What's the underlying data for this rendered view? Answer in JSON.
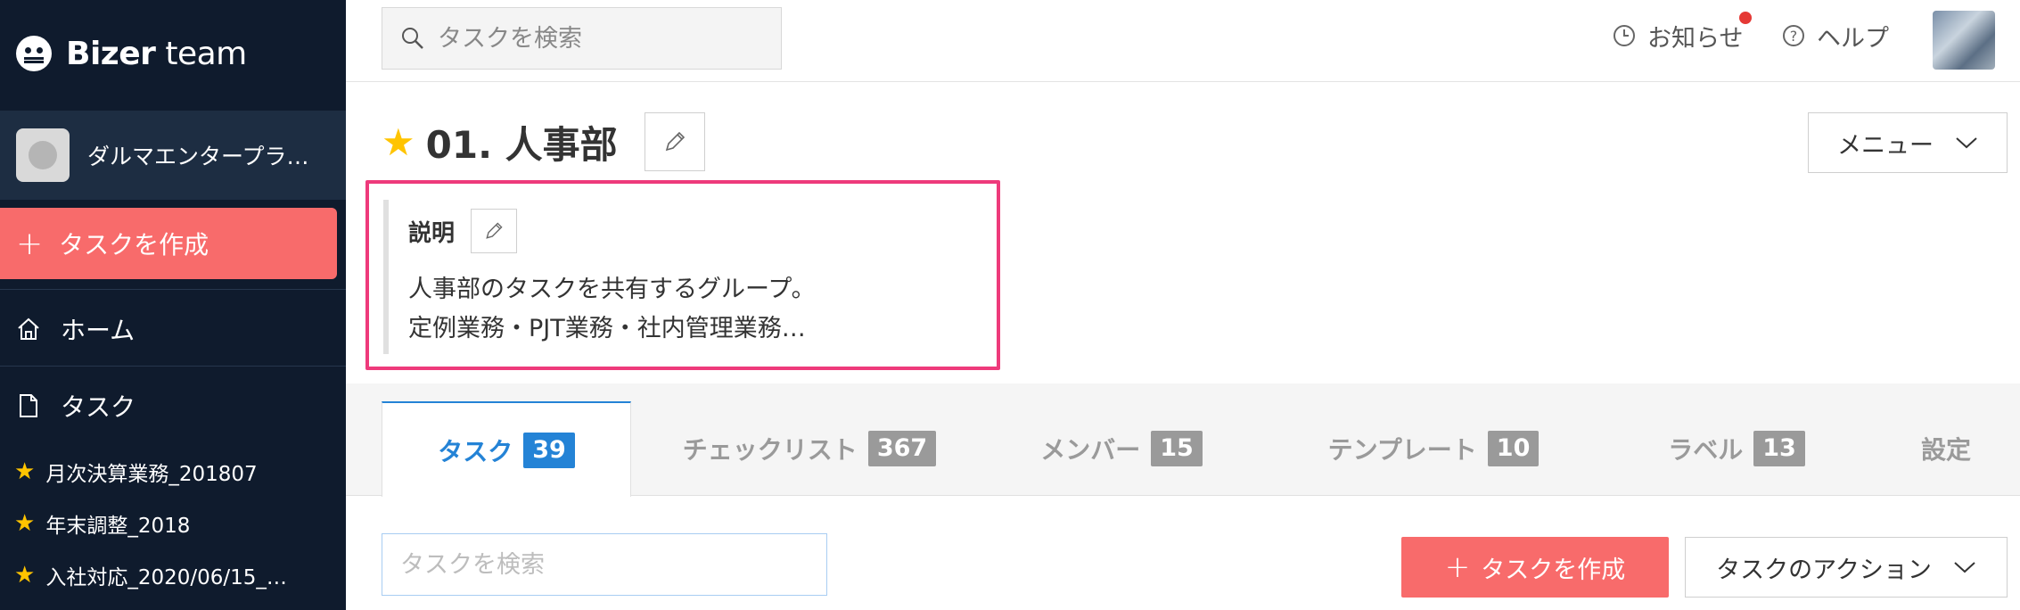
{
  "app": {
    "logo_bold": "Bizer",
    "logo_light": " team"
  },
  "sidebar": {
    "org_name": "ダルマエンタープライズ",
    "create_task_label": "タスクを作成",
    "nav": [
      {
        "label": "ホーム",
        "icon": "home-icon"
      },
      {
        "label": "タスク",
        "icon": "document-icon"
      }
    ],
    "favorites": [
      {
        "label": "月次決算業務_201807"
      },
      {
        "label": "年末調整_2018"
      },
      {
        "label": "入社対応_2020/06/15_…"
      }
    ]
  },
  "topbar": {
    "search_placeholder": "タスクを検索",
    "notifications_label": "お知らせ",
    "help_label": "ヘルプ"
  },
  "header": {
    "title": "01. 人事部",
    "menu_label": "メニュー"
  },
  "description": {
    "label": "説明",
    "line1": "人事部のタスクを共有するグループ。",
    "line2": "定例業務・PJT業務・社内管理業務…"
  },
  "tabs": [
    {
      "label": "タスク",
      "count": "39",
      "active": true
    },
    {
      "label": "チェックリスト",
      "count": "367"
    },
    {
      "label": "メンバー",
      "count": "15"
    },
    {
      "label": "テンプレート",
      "count": "10"
    },
    {
      "label": "ラベル",
      "count": "13"
    },
    {
      "label": "設定",
      "count": ""
    }
  ],
  "toolbar": {
    "search_placeholder": "タスクを検索",
    "create_label": "タスクを作成",
    "actions_label": "タスクのアクション"
  },
  "colors": {
    "sidebar_bg": "#0f1b2d",
    "accent_red": "#f86b6b",
    "accent_blue": "#2483d6",
    "highlight_pink": "#ee3a7b",
    "star_yellow": "#ffc400"
  }
}
